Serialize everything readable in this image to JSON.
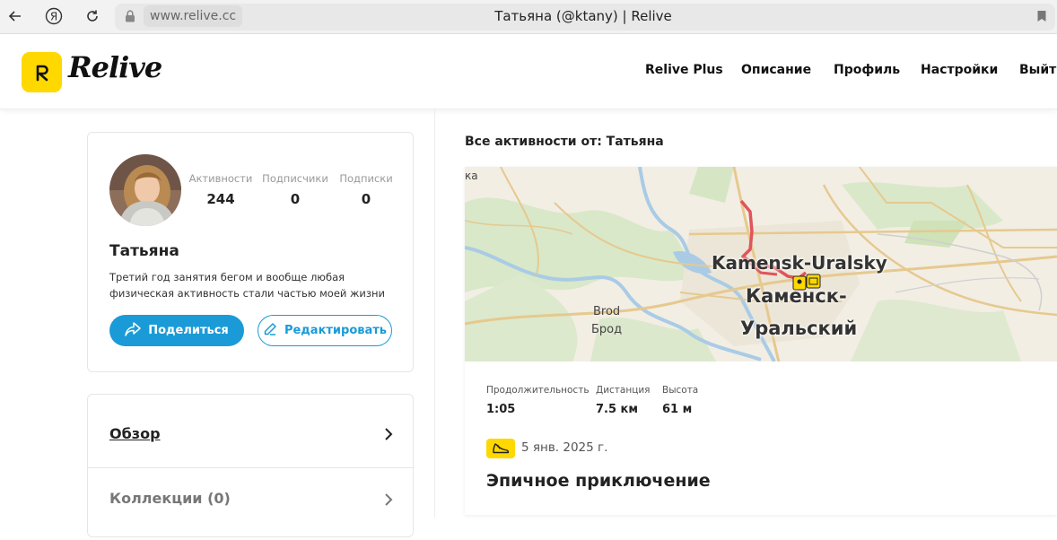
{
  "browser": {
    "url": "www.relive.cc",
    "tab_title": "Татьяна (@ktany) | Relive"
  },
  "header": {
    "logo_text": "Relive",
    "nav": [
      "Relive Plus",
      "Описание",
      "Профиль",
      "Настройки",
      "Выйти"
    ]
  },
  "profile": {
    "stats": [
      {
        "label": "Активности",
        "value": "244"
      },
      {
        "label": "Подписчики",
        "value": "0"
      },
      {
        "label": "Подписки",
        "value": "0"
      }
    ],
    "name": "Татьяна",
    "bio": "Третий год занятия бегом и вообще любая физическая активность стали частью моей жизни",
    "share_label": "Поделиться",
    "edit_label": "Редактировать"
  },
  "menu": {
    "items": [
      {
        "label": "Обзор"
      },
      {
        "label": "Коллекции (0)"
      }
    ]
  },
  "activities": {
    "title": "Все активности от: Татьяна",
    "map_labels": {
      "city_en": "Kamensk-Uralsky",
      "city_ru_1": "Каменск-",
      "city_ru_2": "Уральский",
      "village_en": "Brod",
      "village_ru": "Брод",
      "edge": "ка"
    },
    "metrics": [
      {
        "label": "Продолжительность",
        "value": "1:05"
      },
      {
        "label": "Дистанция",
        "value": "7.5 км"
      },
      {
        "label": "Высота",
        "value": "61 м"
      }
    ],
    "date": "5 янв. 2025 г.",
    "activity_title": "Эпичное приключение"
  },
  "colors": {
    "brand_yellow": "#ffd800",
    "accent_blue": "#1a9bd7",
    "route_red": "#e0545b"
  },
  "icons": {
    "back": "back-arrow-icon",
    "yandex": "yandex-icon",
    "reload": "reload-icon",
    "lock": "lock-icon",
    "bookmark": "bookmark-icon",
    "share": "share-icon",
    "edit": "pencil-icon",
    "chevron": "chevron-right-icon",
    "sport": "shoe-icon"
  }
}
